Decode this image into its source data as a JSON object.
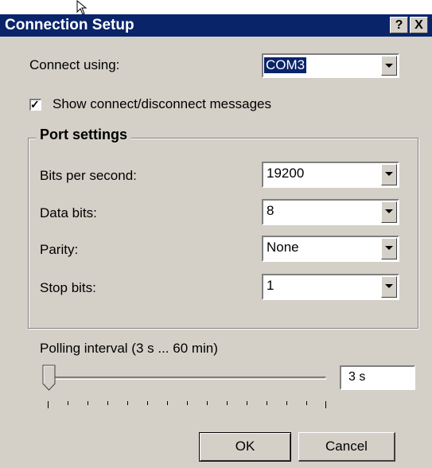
{
  "window": {
    "title": "Connection Setup",
    "help_label": "?",
    "close_label": "X"
  },
  "connect_using": {
    "label": "Connect using:",
    "value": "COM3"
  },
  "show_messages": {
    "label": "Show connect/disconnect messages",
    "checked": true
  },
  "port_settings": {
    "title": "Port settings",
    "fields": [
      {
        "label": "Bits per second:",
        "value": "19200"
      },
      {
        "label": "Data bits:",
        "value": "8"
      },
      {
        "label": "Parity:",
        "value": "None"
      },
      {
        "label": "Stop bits:",
        "value": "1"
      }
    ]
  },
  "polling": {
    "label": "Polling interval (3 s ... 60 min)",
    "value": "3 s",
    "slider_position": 0
  },
  "buttons": {
    "ok": "OK",
    "cancel": "Cancel"
  },
  "colors": {
    "titlebar": "#0a246a",
    "face": "#d4d0c8",
    "selection": "#0a246a"
  }
}
